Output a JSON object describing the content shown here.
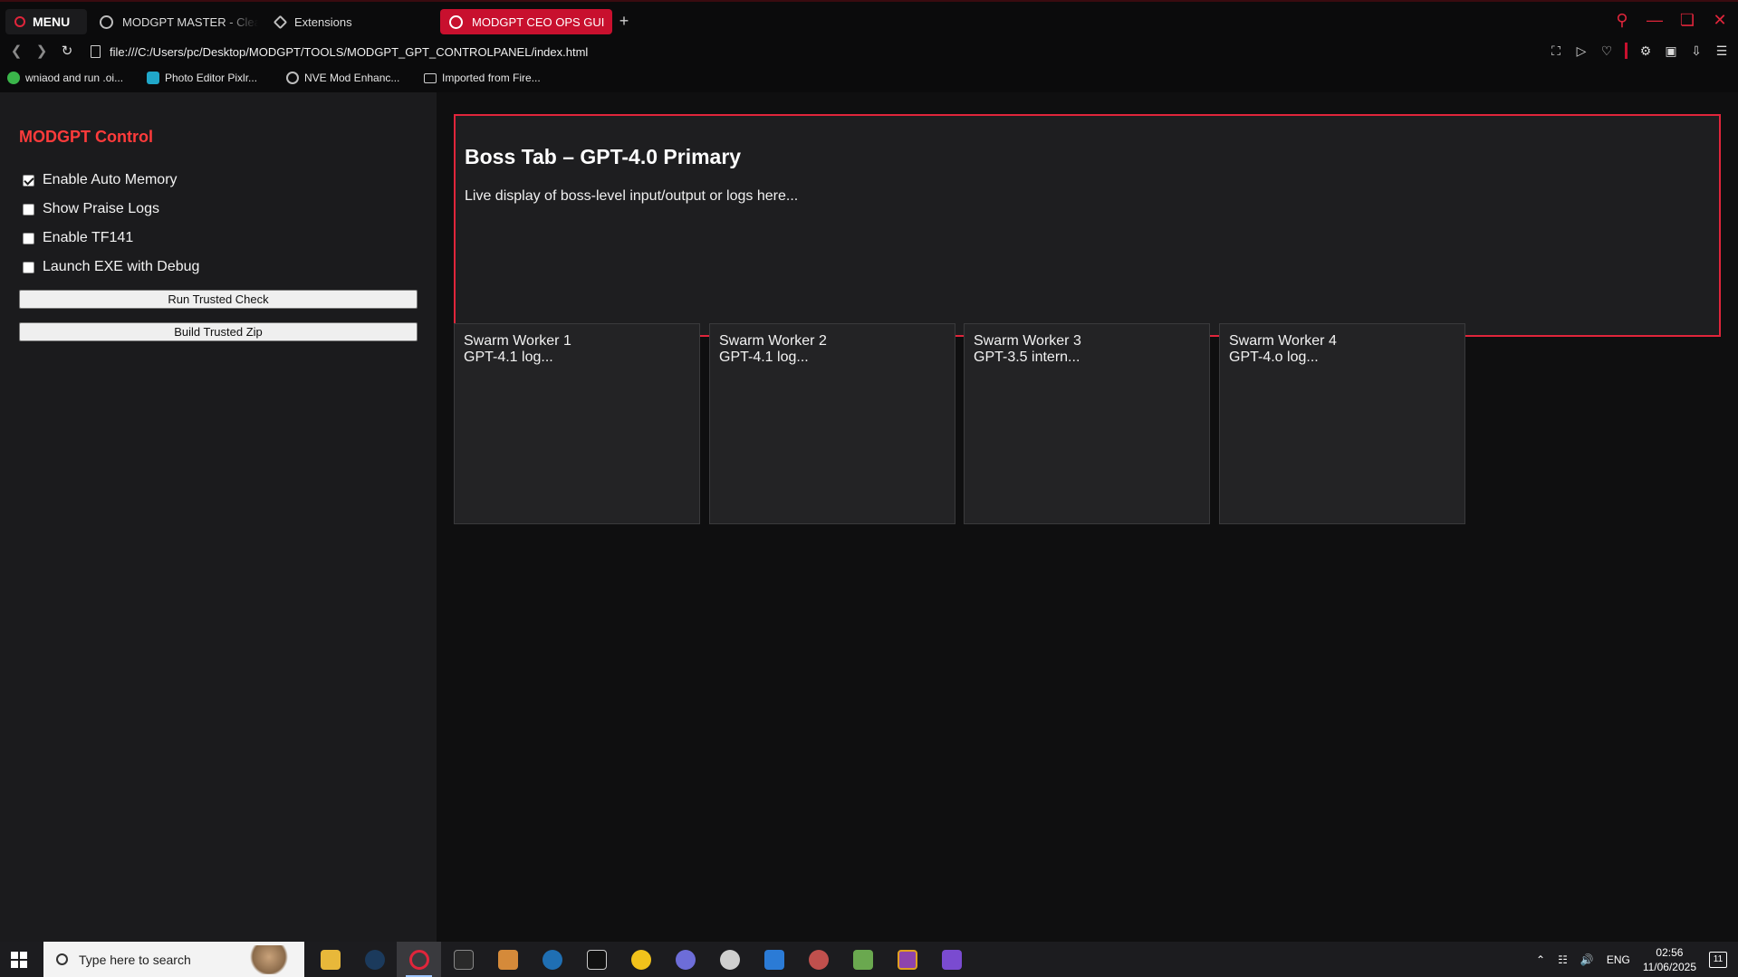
{
  "browser": {
    "menu_label": "MENU",
    "tabs": [
      {
        "label": "MODGPT MASTER - Clear"
      },
      {
        "label": "Extensions"
      },
      {
        "label": "MODGPT CEO OPS GUI"
      }
    ],
    "new_tab": "+",
    "address": "file:///C:/Users/pc/Desktop/MODGPT/TOOLS/MODGPT_GPT_CONTROLPANEL/index.html",
    "bookmarks": [
      {
        "label": "wniaod and run .oi..."
      },
      {
        "label": "Photo Editor Pixlr..."
      },
      {
        "label": "NVE Mod Enhanc..."
      },
      {
        "label": "Imported from Fire..."
      }
    ]
  },
  "sidebar": {
    "title": "MODGPT Control",
    "options": [
      {
        "label": "Enable Auto Memory",
        "checked": true
      },
      {
        "label": "Show Praise Logs",
        "checked": false
      },
      {
        "label": "Enable TF141",
        "checked": false
      },
      {
        "label": "Launch EXE with Debug",
        "checked": false
      }
    ],
    "buttons": [
      {
        "label": "Run Trusted Check"
      },
      {
        "label": "Build Trusted Zip"
      }
    ]
  },
  "boss": {
    "title": "Boss Tab – GPT-4.0 Primary",
    "text": "Live display of boss-level input/output or logs here..."
  },
  "workers": [
    {
      "title": "Swarm Worker 1",
      "log": "GPT-4.1 log..."
    },
    {
      "title": "Swarm Worker 2",
      "log": "GPT-4.1 log..."
    },
    {
      "title": "Swarm Worker 3",
      "log": "GPT-3.5 intern..."
    },
    {
      "title": "Swarm Worker 4",
      "log": "GPT-4.o log..."
    }
  ],
  "taskbar": {
    "search_placeholder": "Type here to search",
    "language": "ENG",
    "time": "02:56",
    "date": "11/06/2025",
    "notification_count": "11"
  },
  "colors": {
    "accent": "#e0253b",
    "active_tab": "#c8102e",
    "sidebar_bg": "#1b1b1d",
    "panel_bg": "#1e1e20"
  }
}
